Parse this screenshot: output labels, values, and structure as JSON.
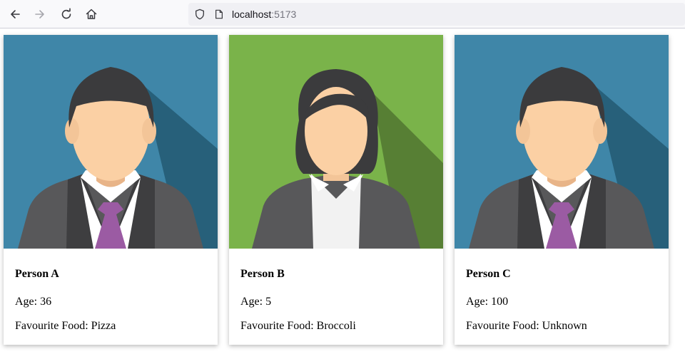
{
  "browser": {
    "url_host": "localhost",
    "url_port": ":5173"
  },
  "people": [
    {
      "name": "Person A",
      "age_label": "Age: 36",
      "food_label": "Favourite Food: Pizza",
      "avatar": "male-avatar",
      "bg_color": "#3f86a8",
      "has_tie": true
    },
    {
      "name": "Person B",
      "age_label": "Age: 5",
      "food_label": "Favourite Food: Broccoli",
      "avatar": "female-avatar",
      "bg_color": "#7ab34a",
      "has_tie": false
    },
    {
      "name": "Person C",
      "age_label": "Age: 100",
      "food_label": "Favourite Food: Unknown",
      "avatar": "male-avatar",
      "bg_color": "#3f86a8",
      "has_tie": true
    }
  ]
}
